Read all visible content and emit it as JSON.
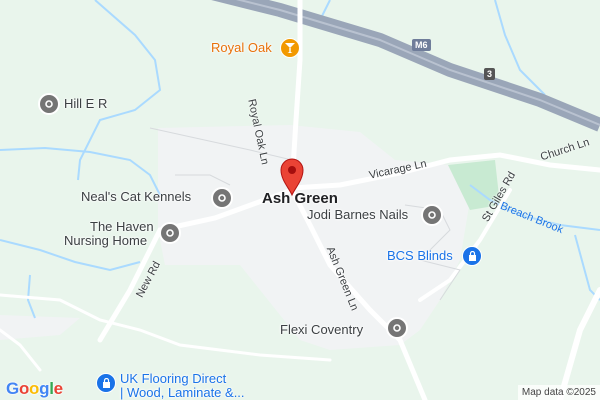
{
  "map": {
    "colors": {
      "land": "#e9f5ec",
      "urban": "#f1f3f4",
      "road": "#ffffff",
      "motorway": "#9aa6b8",
      "water": "#aadaff",
      "park": "#c8ead2",
      "pin": "#ea4335"
    },
    "town": "Ash Green",
    "places": [
      {
        "id": "hill-er",
        "label": "Hill E R",
        "icon": "place-icon"
      },
      {
        "id": "neals",
        "label": "Neal's Cat Kennels",
        "icon": "place-icon"
      },
      {
        "id": "haven1",
        "label": "The Haven",
        "icon": "place-icon"
      },
      {
        "id": "haven2",
        "label": "Nursing Home",
        "icon": "place-icon"
      },
      {
        "id": "jodi",
        "label": "Jodi Barnes Nails",
        "icon": "place-icon"
      },
      {
        "id": "bcs",
        "label": "BCS Blinds",
        "icon": "shopping-bag-icon"
      },
      {
        "id": "flexi",
        "label": "Flexi Coventry",
        "icon": "place-icon"
      },
      {
        "id": "royal",
        "label": "Royal Oak",
        "icon": "cocktail-icon"
      },
      {
        "id": "uk1",
        "label": "UK Flooring Direct",
        "icon": "shopping-bag-icon"
      },
      {
        "id": "uk2",
        "label": "| Wood, Laminate &...",
        "icon": ""
      }
    ],
    "roads": {
      "royal_oak": "Royal Oak Ln",
      "vicarage": "Vicarage Ln",
      "church": "Church Ln",
      "st_giles": "St Giles Rd",
      "new_rd": "New Rd",
      "ash_green_ln": "Ash Green Ln"
    },
    "water": {
      "breach_brook": "Breach Brook"
    },
    "motorway": {
      "name": "M6",
      "junction": "3"
    },
    "branding": {
      "g1": "G",
      "o1": "o",
      "o2": "o",
      "g2": "g",
      "l": "l",
      "e": "e"
    },
    "attribution": "Map data ©2025"
  }
}
